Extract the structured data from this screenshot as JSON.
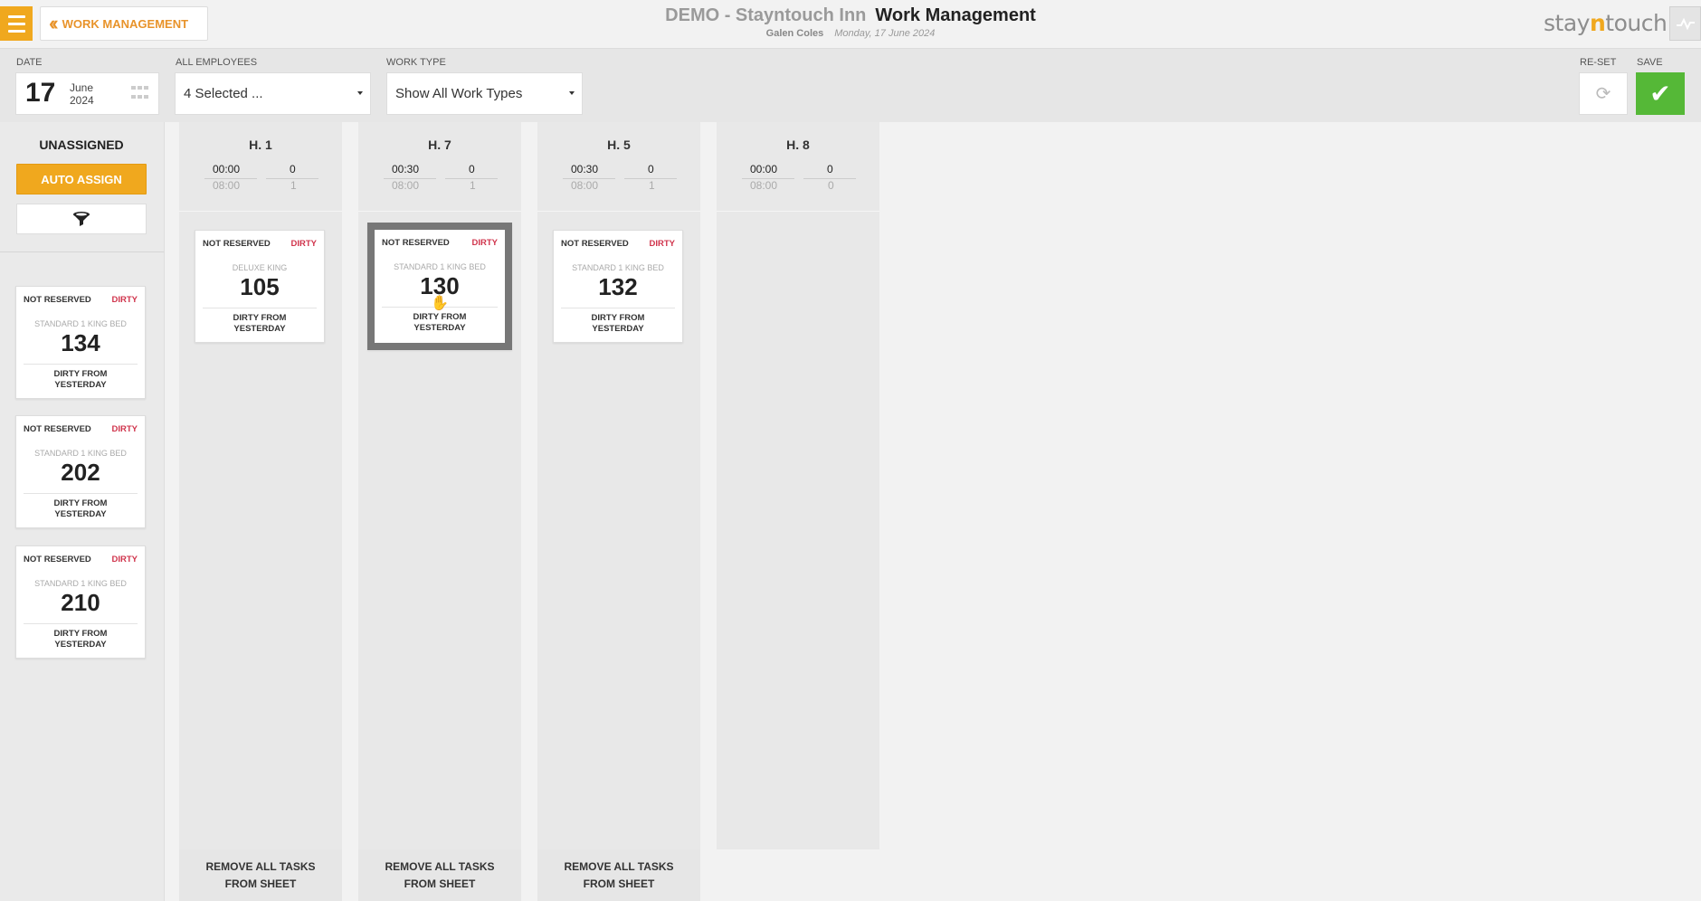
{
  "header": {
    "back_label": "WORK MANAGEMENT",
    "inn_name": "DEMO - Stayntouch Inn",
    "page_title": "Work Management",
    "user_name": "Galen Coles",
    "date_text": "Monday, 17 June 2024",
    "logo_prefix": "stay",
    "logo_n": "n",
    "logo_suffix": "touch"
  },
  "filters": {
    "date_label": "DATE",
    "date_day": "17",
    "date_month": "June",
    "date_year": "2024",
    "employees_label": "ALL EMPLOYEES",
    "employees_value": "4 Selected ...",
    "worktype_label": "WORK TYPE",
    "worktype_value": "Show All Work Types",
    "reset_label": "RE-SET",
    "save_label": "SAVE"
  },
  "unassigned": {
    "title": "UNASSIGNED",
    "auto_assign_label": "AUTO ASSIGN",
    "cards": [
      {
        "reservation": "NOT RESERVED",
        "status": "DIRTY",
        "room_type": "STANDARD 1 KING BED",
        "room": "134",
        "note_1": "DIRTY FROM",
        "note_2": "YESTERDAY"
      },
      {
        "reservation": "NOT RESERVED",
        "status": "DIRTY",
        "room_type": "STANDARD 1 KING BED",
        "room": "202",
        "note_1": "DIRTY FROM",
        "note_2": "YESTERDAY"
      },
      {
        "reservation": "NOT RESERVED",
        "status": "DIRTY",
        "room_type": "STANDARD 1 KING BED",
        "room": "210",
        "note_1": "DIRTY FROM",
        "note_2": "YESTERDAY"
      }
    ]
  },
  "columns": [
    {
      "name": "H. 1",
      "time_assigned": "00:00",
      "time_total": "08:00",
      "count_assigned": "0",
      "count_total": "1",
      "card": {
        "reservation": "NOT RESERVED",
        "status": "DIRTY",
        "room_type": "DELUXE KING",
        "room": "105",
        "note_1": "DIRTY FROM",
        "note_2": "YESTERDAY"
      },
      "remove_1": "REMOVE ALL TASKS",
      "remove_2": "FROM SHEET"
    },
    {
      "name": "H. 7",
      "time_assigned": "00:30",
      "time_total": "08:00",
      "count_assigned": "0",
      "count_total": "1",
      "card": {
        "reservation": "NOT RESERVED",
        "status": "DIRTY",
        "room_type": "STANDARD 1 KING BED",
        "room": "130",
        "note_1": "DIRTY FROM",
        "note_2": "YESTERDAY"
      },
      "remove_1": "REMOVE ALL TASKS",
      "remove_2": "FROM SHEET"
    },
    {
      "name": "H. 5",
      "time_assigned": "00:30",
      "time_total": "08:00",
      "count_assigned": "0",
      "count_total": "1",
      "card": {
        "reservation": "NOT RESERVED",
        "status": "DIRTY",
        "room_type": "STANDARD 1 KING BED",
        "room": "132",
        "note_1": "DIRTY FROM",
        "note_2": "YESTERDAY"
      },
      "remove_1": "REMOVE ALL TASKS",
      "remove_2": "FROM SHEET"
    },
    {
      "name": "H. 8",
      "time_assigned": "00:00",
      "time_total": "08:00",
      "count_assigned": "0",
      "count_total": "0"
    }
  ],
  "colors": {
    "accent": "#f0a81e",
    "dirty": "#d0344c",
    "save": "#55b837"
  },
  "icons": {
    "menu": "hamburger-icon",
    "back": "double-chevron-left-icon",
    "calendar": "calendar-grid-icon",
    "filter": "funnel-icon",
    "reset": "refresh-icon",
    "save": "checkmark-icon",
    "activity": "activity-icon",
    "cursor": "hand-cursor-icon"
  }
}
